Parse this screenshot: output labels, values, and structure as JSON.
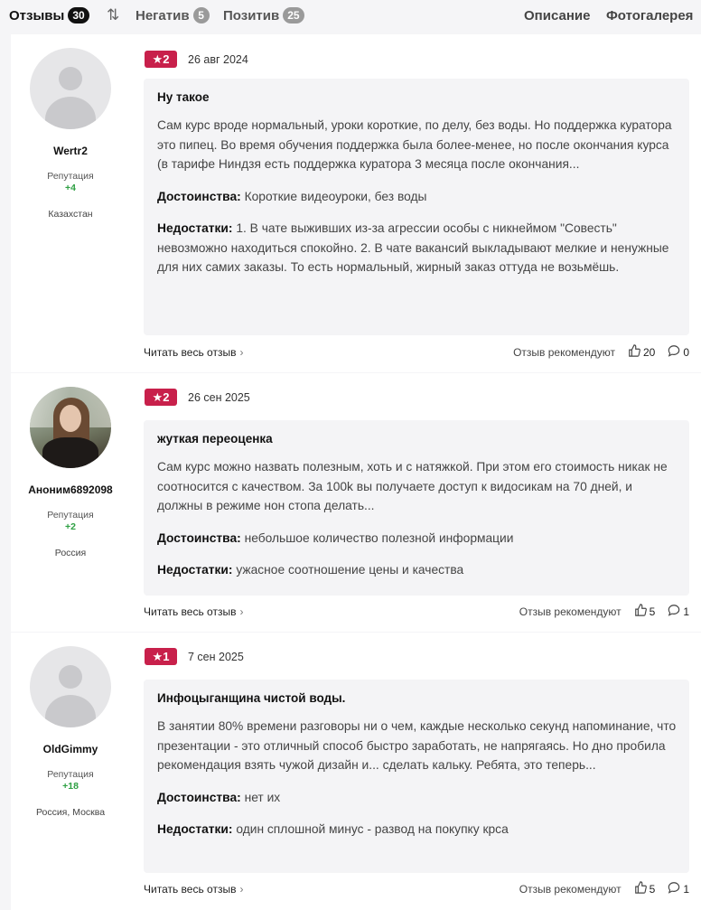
{
  "tabs": {
    "all": {
      "label": "Отзывы",
      "count": "30"
    },
    "negative": {
      "label": "Негатив",
      "count": "5"
    },
    "positive": {
      "label": "Позитив",
      "count": "25"
    },
    "description": "Описание",
    "photos": "Фотогалерея"
  },
  "labels": {
    "reputation": "Репутация",
    "read_full": "Читать весь отзыв",
    "recommend": "Отзыв рекомендуют",
    "pros": "Достоинства:",
    "cons": "Недостатки:"
  },
  "colors": {
    "rating_badge": "#c8204b",
    "reputation_positive": "#2ea043"
  },
  "reviews": [
    {
      "author": "Wertr2",
      "reputation": "+4",
      "country": "Казахстан",
      "rating": "2",
      "date": "26 авг 2024",
      "title": "Ну такое",
      "text": "Сам курс вроде нормальный, уроки короткие, по делу, без воды. Но поддержка куратора это пипец. Во время обучения поддержка была более-менее, но после окончания курса (в тарифе Ниндзя есть поддержка куратора 3 месяца после окончания...",
      "pros": "Короткие видеоуроки, без воды",
      "cons": "1. В чате выживших из-за агрессии особы с никнеймом \"Совесть\" невозможно находиться спокойно. 2. В чате вакансий выкладывают мелкие и ненужные для них самих заказы. То есть нормальный, жирный заказ оттуда не возьмёшь.",
      "likes": "20",
      "comments": "0",
      "avatar": "default-avatar"
    },
    {
      "author": "Аноним6892098",
      "reputation": "+2",
      "country": "Россия",
      "rating": "2",
      "date": "26 сен 2025",
      "title": "жуткая переоценка",
      "text": "Сам курс можно назвать полезным, хоть и с натяжкой. При этом его стоимость никак не соотносится с качеством. За 100k вы получаете доступ к видосикам на 70 дней, и должны в режиме нон стопа делать...",
      "pros": "небольшое количество полезной информации",
      "cons": "ужасное соотношение цены и качества",
      "likes": "5",
      "comments": "1",
      "avatar": "photo-avatar"
    },
    {
      "author": "OldGimmy",
      "reputation": "+18",
      "country": "Россия, Москва",
      "rating": "1",
      "date": "7 сен 2025",
      "title": "Инфоцыганщина чистой воды.",
      "text": "В занятии 80% времени разговоры ни о чем, каждые несколько секунд напоминание, что презентации - это отличный способ быстро заработать, не напрягаясь. Но дно пробила рекомендация взять чужой дизайн и... сделать кальку. Ребята, это теперь...",
      "pros": "нет их",
      "cons": "один сплошной минус - развод на покупку крса",
      "likes": "5",
      "comments": "1",
      "avatar": "default-avatar"
    }
  ]
}
